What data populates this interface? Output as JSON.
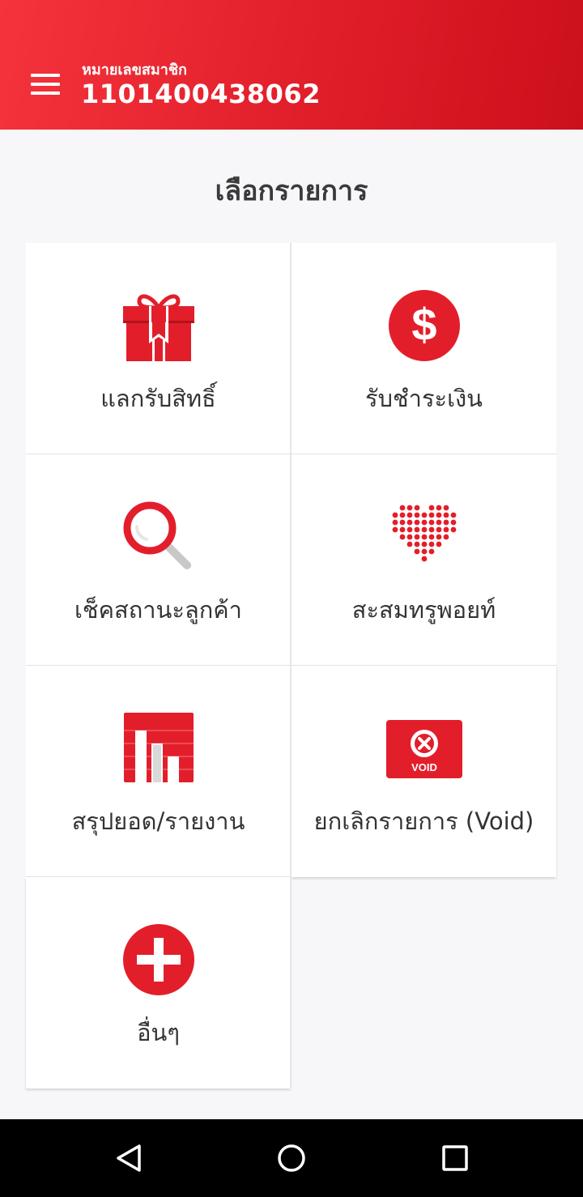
{
  "header": {
    "member_label": "หมายเลขสมาชิก",
    "member_number": "1101400438062"
  },
  "page": {
    "title": "เลือกรายการ"
  },
  "menu": {
    "items": [
      {
        "label": "แลกรับสิทธิ์",
        "icon": "gift-icon"
      },
      {
        "label": "รับชำระเงิน",
        "icon": "dollar-icon"
      },
      {
        "label": "เช็คสถานะลูกค้า",
        "icon": "magnifier-icon"
      },
      {
        "label": "สะสมทรูพอยท์",
        "icon": "dotted-heart-icon"
      },
      {
        "label": "สรุปยอด/รายงาน",
        "icon": "bar-chart-icon"
      },
      {
        "label": "ยกเลิกรายการ (Void)",
        "icon": "void-icon"
      },
      {
        "label": "อื่นๆ",
        "icon": "plus-icon"
      }
    ],
    "void_badge": "VOID"
  },
  "colors": {
    "brand_red": "#e31e2b",
    "header_start": "#f5333c",
    "header_end": "#cc101b"
  },
  "navigation": {
    "back": "back-icon",
    "home": "home-icon",
    "recents": "recents-icon"
  }
}
